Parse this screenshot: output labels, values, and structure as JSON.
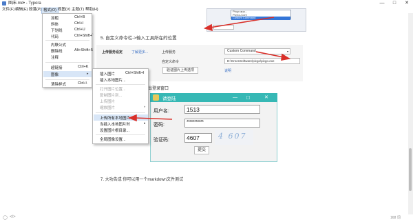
{
  "window": {
    "title": "图床.md• - Typora",
    "controls": {
      "minimize": "—",
      "maximize": "□",
      "close": "✕"
    }
  },
  "menubar": [
    "文件(F)",
    "编辑(E)",
    "段落(P)",
    "格式(O)",
    "视图(V)",
    "主题(T)",
    "帮助(H)"
  ],
  "format_menu": {
    "items": [
      {
        "label": "加粗",
        "shortcut": "Ctrl+B"
      },
      {
        "label": "斜体",
        "shortcut": "Ctrl+I"
      },
      {
        "label": "下划线",
        "shortcut": "Ctrl+U"
      },
      {
        "label": "代码",
        "shortcut": "Ctrl+Shift+`"
      },
      {
        "label": "内联公式",
        "shortcut": ""
      },
      {
        "label": "删除线",
        "shortcut": "Alt+Shift+5"
      },
      {
        "label": "注释",
        "shortcut": ""
      },
      {
        "label": "超链接",
        "shortcut": "Ctrl+K"
      },
      {
        "label": "图像",
        "shortcut": ""
      },
      {
        "label": "清除样式",
        "shortcut": "Ctrl+\\"
      }
    ]
  },
  "image_submenu": {
    "items": [
      {
        "label": "插入图片",
        "shortcut": "Ctrl+Shift+I",
        "enabled": true
      },
      {
        "label": "插入本地图片...",
        "shortcut": "",
        "enabled": true
      },
      {
        "label": "打开图片位置...",
        "shortcut": "",
        "enabled": false
      },
      {
        "label": "复制图片到...",
        "shortcut": "",
        "enabled": false
      },
      {
        "label": "上传图片",
        "shortcut": "",
        "enabled": false
      },
      {
        "label": "缩放图片",
        "shortcut": "",
        "enabled": false
      },
      {
        "label": "上传所有本地图片",
        "shortcut": "",
        "enabled": true
      },
      {
        "label": "当插入本地图片时",
        "shortcut": "",
        "enabled": true
      },
      {
        "label": "设置图片根目录...",
        "shortcut": "",
        "enabled": true
      },
      {
        "label": "全局图像设置...",
        "shortcut": "",
        "enabled": true
      }
    ]
  },
  "document": {
    "dropdown_options": [
      "Picgo.app...",
      "PicGo-Core",
      "Custom Command"
    ],
    "step5_heading": "5. 自定义命令栏->输入工具所在的位置",
    "upload_service_settings": "上传服务设定",
    "see_more_link": "了解更多...",
    "upload_service_label": "上传服务",
    "upload_service_value": "Custom Command",
    "custom_command_label": "自定义命令",
    "custom_command_value": "D:\\GreenSoftware\\picgo\\picgo.exe",
    "verify_button": "验证图片上传选项",
    "preview_link": "说明",
    "step6_fragment": "出登录窗口",
    "step7": "7. 大功告成 你可以用一个markdown文件测试"
  },
  "login_window": {
    "title": "请登陆",
    "username_label": "用户名:",
    "username_value": "1513",
    "password_label": "密码:",
    "password_value": "***********",
    "captcha_label": "验证码:",
    "captcha_value": "4607",
    "captcha_image_text": "4 607",
    "submit_button": "提交",
    "controls": {
      "minimize": "—",
      "maximize": "□",
      "close": "✕"
    }
  },
  "statusbar": {
    "word_count": "168 词"
  },
  "colors": {
    "accent": "#36b8b5",
    "arrow_red": "#d9302a",
    "link_blue": "#3a6fc4",
    "menu_highlight": "#d8e6f7"
  }
}
